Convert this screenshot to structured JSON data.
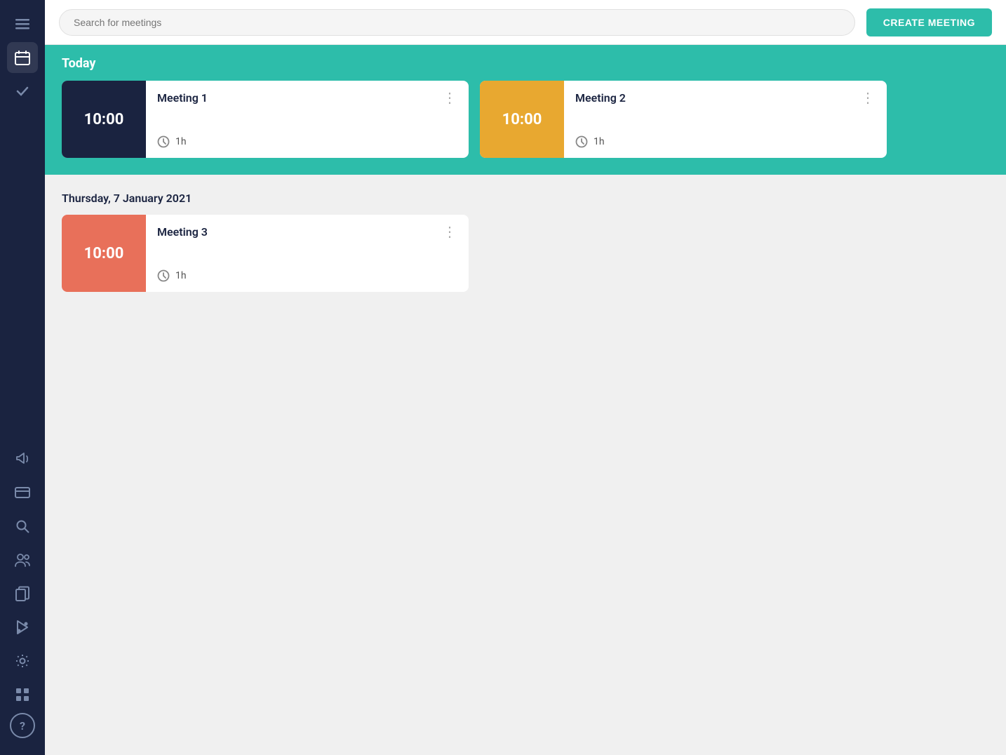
{
  "sidebar": {
    "icons": [
      {
        "name": "menu-icon",
        "symbol": "☰",
        "active": false
      },
      {
        "name": "calendar-icon",
        "symbol": "📅",
        "active": true
      },
      {
        "name": "check-icon",
        "symbol": "✓",
        "active": false
      },
      {
        "name": "megaphone-icon",
        "symbol": "📢",
        "active": false
      },
      {
        "name": "card-icon",
        "symbol": "▬",
        "active": false
      },
      {
        "name": "search-icon",
        "symbol": "🔍",
        "active": false
      },
      {
        "name": "people-icon",
        "symbol": "👥",
        "active": false
      },
      {
        "name": "copy-icon",
        "symbol": "⧉",
        "active": false
      },
      {
        "name": "shape-icon",
        "symbol": "▲",
        "active": false
      },
      {
        "name": "settings-icon",
        "symbol": "⚙",
        "active": false
      },
      {
        "name": "grid-icon",
        "symbol": "⊞",
        "active": false
      }
    ],
    "bottom_icons": [
      {
        "name": "help-icon",
        "symbol": "?",
        "active": false
      }
    ]
  },
  "topbar": {
    "search_placeholder": "Search for meetings",
    "create_button_label": "CREATE MEETING"
  },
  "today_section": {
    "label": "Today",
    "meetings": [
      {
        "id": "meeting-1",
        "title": "Meeting 1",
        "time": "10:00",
        "duration": "1h",
        "color_class": "navy"
      },
      {
        "id": "meeting-2",
        "title": "Meeting 2",
        "time": "10:00",
        "duration": "1h",
        "color_class": "amber"
      }
    ]
  },
  "future_section": {
    "date": "Thursday, 7 January 2021",
    "meetings": [
      {
        "id": "meeting-3",
        "title": "Meeting 3",
        "time": "10:00",
        "duration": "1h",
        "color_class": "coral"
      }
    ]
  },
  "colors": {
    "teal": "#2dbdaa",
    "navy": "#1a2340",
    "amber": "#e8a830",
    "coral": "#e8705a",
    "white": "#ffffff"
  }
}
